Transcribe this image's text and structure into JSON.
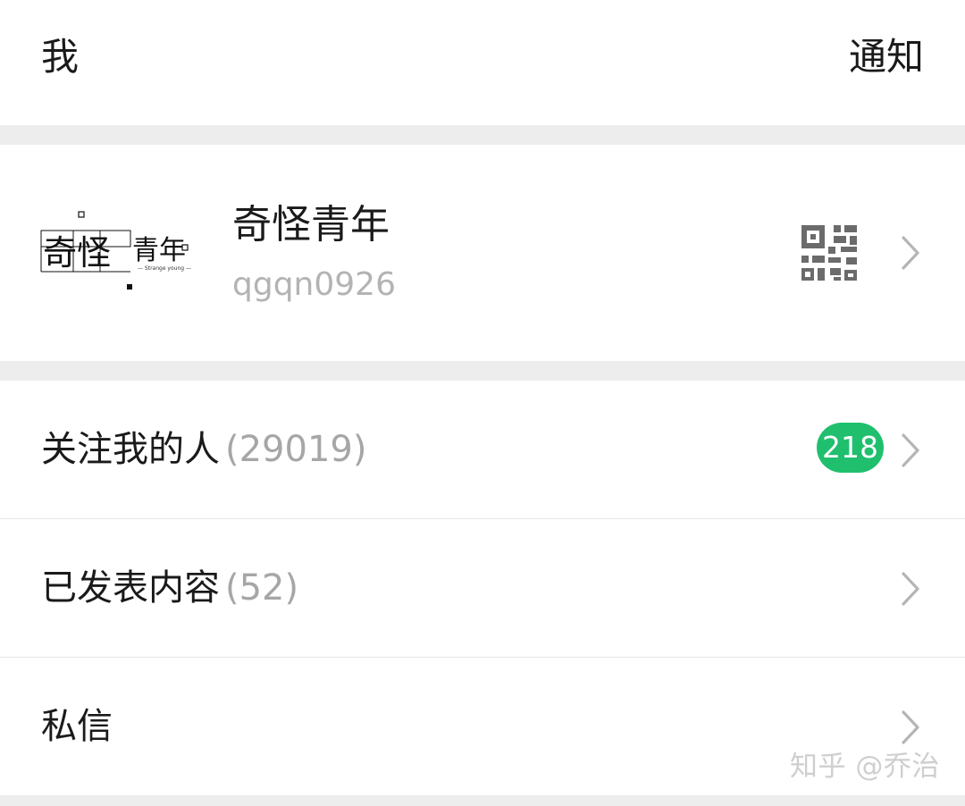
{
  "header": {
    "title": "我",
    "action_label": "通知"
  },
  "profile": {
    "name": "奇怪青年",
    "id": "qgqn0926",
    "logo_text": "奇怪青年",
    "logo_subtext": "Strange young",
    "qr_icon": "qr-code-icon",
    "chevron_icon": "chevron-right-icon"
  },
  "menu": {
    "followers": {
      "label": "关注我的人",
      "count": "(29019)",
      "badge": "218"
    },
    "published": {
      "label": "已发表内容",
      "count": "(52)"
    },
    "messages": {
      "label": "私信"
    }
  },
  "watermark": "知乎 @乔治",
  "colors": {
    "badge": "#1fbf6e",
    "background": "#ededed",
    "muted_text": "#a6a6a6"
  }
}
